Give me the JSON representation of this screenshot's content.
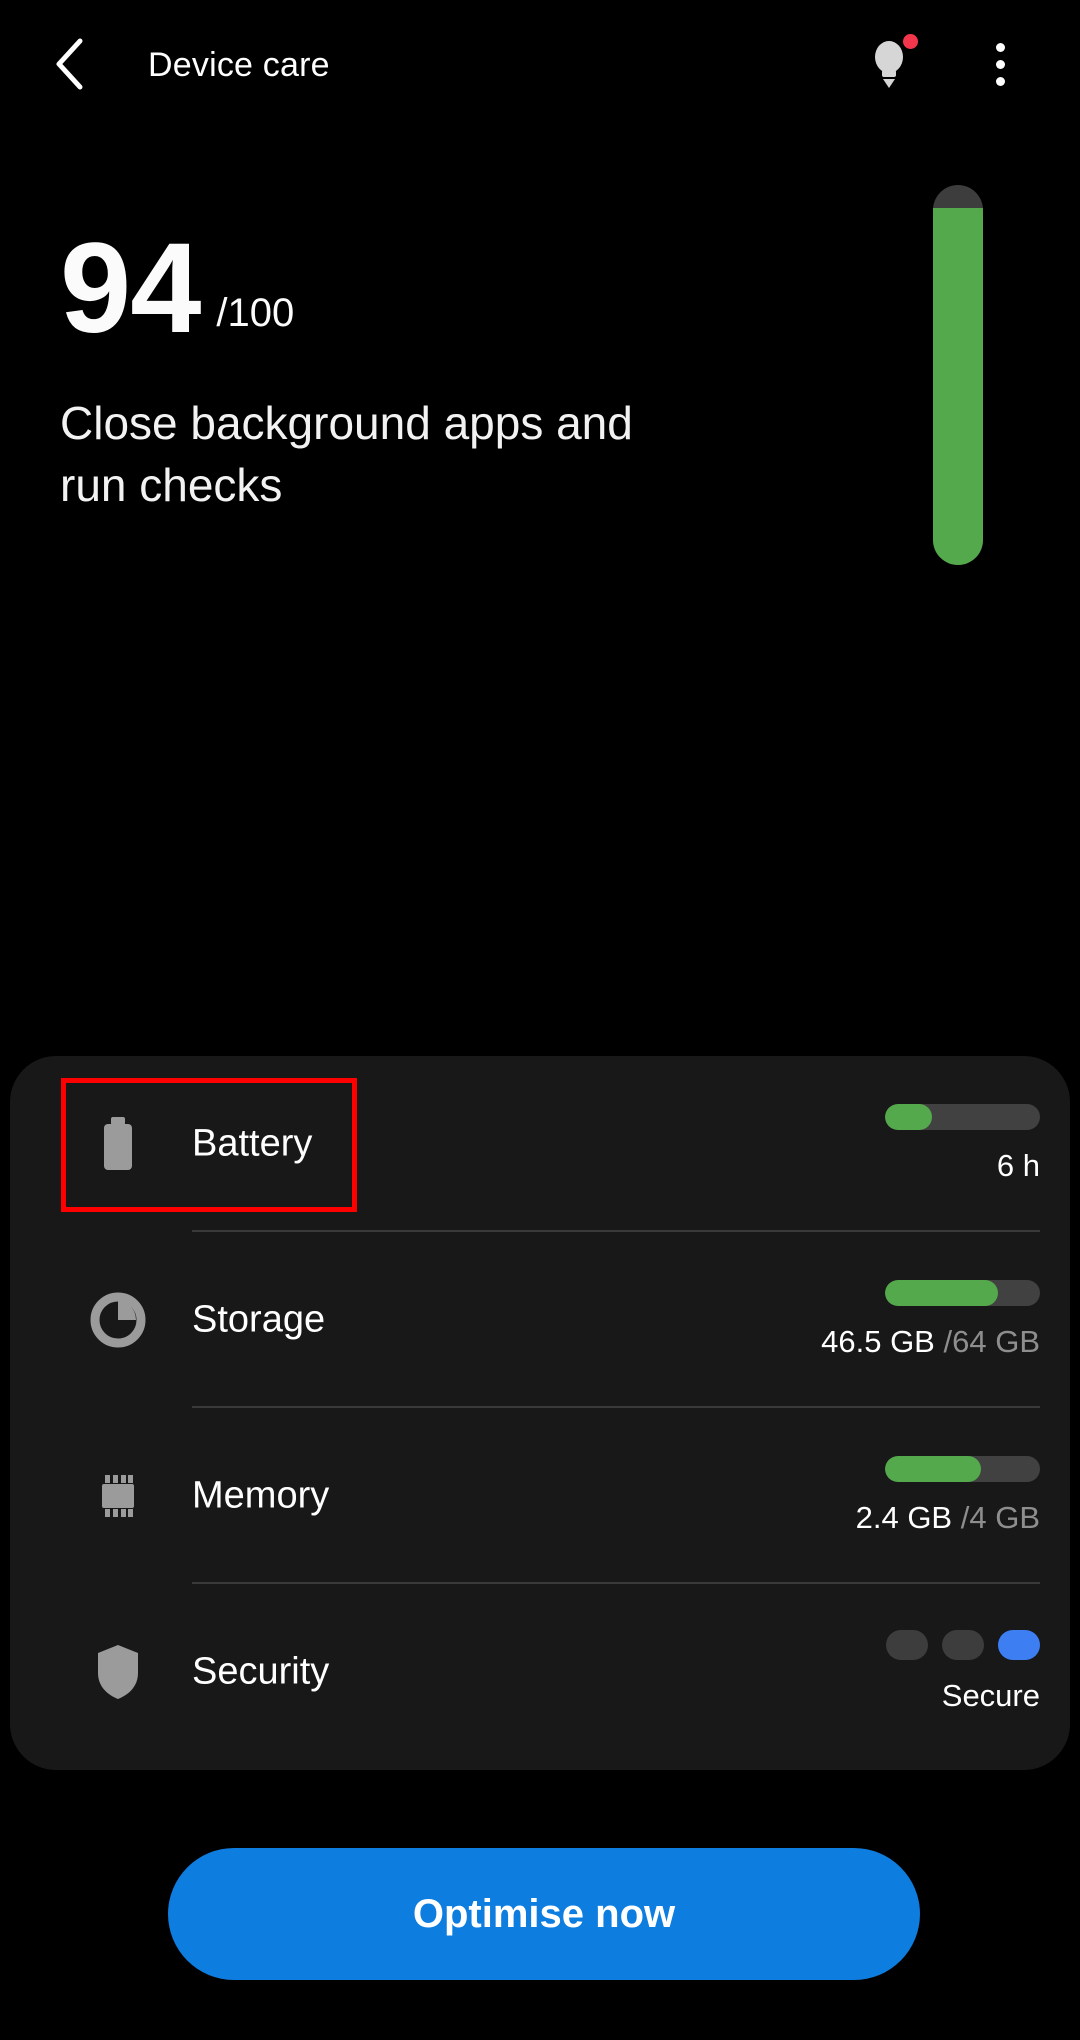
{
  "header": {
    "back_icon": "chevron-left-icon",
    "title": "Device care",
    "tips_icon": "lightbulb-icon",
    "tips_badge": true,
    "more_icon": "overflow-menu-icon"
  },
  "score": {
    "value": "94",
    "total": "/100",
    "max": 100,
    "subtitle": "Close background apps and run checks",
    "gauge_percent": 94,
    "gauge_color": "#53a94b",
    "gauge_track_color": "#3d3d3d"
  },
  "items": [
    {
      "id": "battery",
      "icon": "battery-icon",
      "label": "Battery",
      "bar_percent": 30,
      "sub_primary": "6 h",
      "sub_secondary": "",
      "highlighted": true
    },
    {
      "id": "storage",
      "icon": "pie-chart-icon",
      "label": "Storage",
      "bar_percent": 73,
      "sub_primary": "46.5 GB",
      "sub_secondary": "/64 GB",
      "highlighted": false
    },
    {
      "id": "memory",
      "icon": "memory-chip-icon",
      "label": "Memory",
      "bar_percent": 62,
      "sub_primary": "2.4 GB",
      "sub_secondary": "/4 GB",
      "highlighted": false
    },
    {
      "id": "security",
      "icon": "shield-icon",
      "label": "Security",
      "segments": [
        "inactive",
        "inactive",
        "active"
      ],
      "active_color": "#3d7ef2",
      "sub_primary": "Secure",
      "sub_secondary": "",
      "highlighted": false
    }
  ],
  "cta": {
    "label": "Optimise now",
    "color": "#0d7de0"
  },
  "highlight": {
    "color": "#ff0000",
    "target": "battery"
  }
}
